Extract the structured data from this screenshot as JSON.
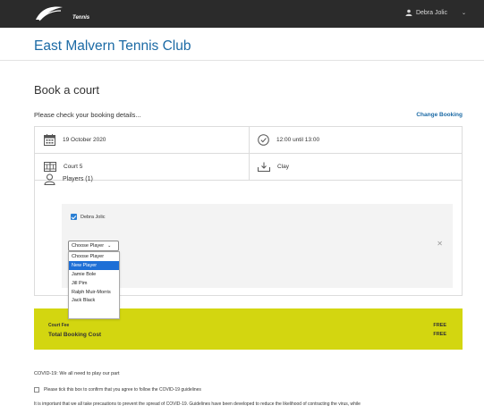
{
  "header": {
    "logo_text": "Tennis",
    "user_name": "Debra Jolic"
  },
  "club": {
    "title": "East Malvern Tennis Club"
  },
  "booking": {
    "title": "Book a court",
    "intro": "Please check your booking details...",
    "change_label": "Change Booking",
    "date": "19 October 2020",
    "time": "12:00 until 13:00",
    "court": "Court 5",
    "surface": "Clay",
    "players_label": "Players (1)",
    "player_checked": "Debra Jolic",
    "select_value": "Choose Player",
    "dropdown_options": [
      "Choose Player",
      "New Player",
      "Jamie Bole",
      "Jill Pim",
      "Ralph Muir-Morris",
      "Jack Black"
    ],
    "dropdown_active_index": 1
  },
  "cost": {
    "court_fee_label": "Court Fee",
    "court_fee_value": "FREE",
    "total_label": "Total Booking Cost",
    "total_value": "FREE"
  },
  "covid": {
    "heading": "COVID-19: We all need to play our part",
    "checkbox_label": "Please tick this box to confirm that you agree to follow the COVID-19 guidelines",
    "body": "It is important that we all take precautions to prevent the spread of COVID-19. Guidelines have been developed to reduce the likelihood of contracting the virus, while"
  },
  "colors": {
    "accent": "#1b6aa5",
    "cost_band": "#d3d610",
    "topbar": "#2b2b2b",
    "dropdown_active": "#1e6fd6"
  },
  "icons": {
    "calendar": "calendar-icon",
    "clock": "clock-icon",
    "court": "court-grid-icon",
    "surface": "surface-tray-icon",
    "players": "person-icon",
    "user": "user-icon"
  }
}
